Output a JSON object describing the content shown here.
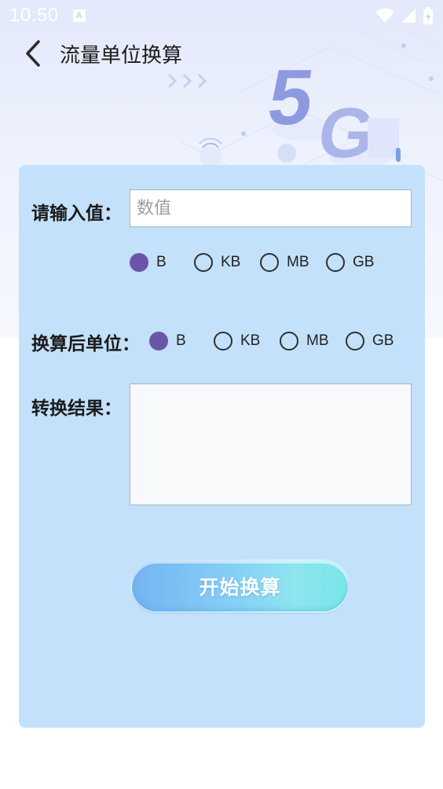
{
  "status_bar": {
    "time": "10:50",
    "notification_icon": "a-icon"
  },
  "header": {
    "title": "流量单位换算",
    "back_icon": "chevron-left-icon"
  },
  "input_row": {
    "label": "请输入值：",
    "placeholder": "数值",
    "value": ""
  },
  "source_units": {
    "options": [
      "B",
      "KB",
      "MB",
      "GB"
    ],
    "selected": "B"
  },
  "target_row": {
    "label": "换算后单位：",
    "options": [
      "B",
      "KB",
      "MB",
      "GB"
    ],
    "selected": "B"
  },
  "result_row": {
    "label": "转换结果：",
    "value": ""
  },
  "convert_button": {
    "label": "开始换算"
  },
  "colors": {
    "card_bg": "#c3e1fa",
    "radio_checked": "#6a55a8",
    "header_bg": "#e3e8fb"
  }
}
